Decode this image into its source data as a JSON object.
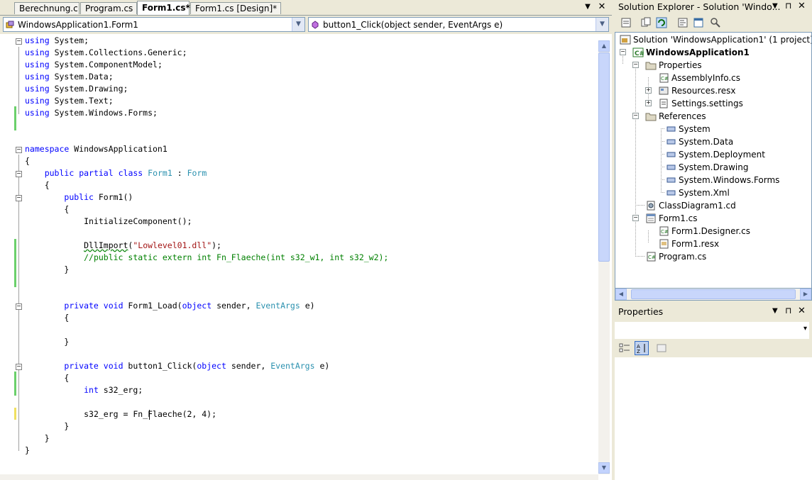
{
  "tabs": [
    {
      "label": "Berechnung.c",
      "active": false
    },
    {
      "label": "Program.cs",
      "active": false
    },
    {
      "label": "Form1.cs*",
      "active": true
    },
    {
      "label": "Form1.cs [Design]*",
      "active": false
    }
  ],
  "nav": {
    "class_combo": "WindowsApplication1.Form1",
    "member_combo": "button1_Click(object sender, EventArgs e)"
  },
  "code": {
    "l1": "System;",
    "l2": "System.Collections.Generic;",
    "l3": "System.ComponentModel;",
    "l4": "System.Data;",
    "l5": "System.Drawing;",
    "l6": "System.Text;",
    "l7": "System.Windows.Forms;",
    "kw_using": "using",
    "kw_namespace": "namespace",
    "namespace_name": " WindowsApplication1",
    "brace_open": "{",
    "brace_close": "}",
    "kw_public": "public",
    "kw_partial": "partial",
    "kw_class": "class",
    "type_form1": "Form1",
    "colon": " : ",
    "type_form": "Form",
    "ctor": " Form1()",
    "init": "InitializeComponent();",
    "dllimport": "DllImport",
    "paren_open": "(",
    "dll_string": "\"Lowlevel01.dll\"",
    "paren_close": ");",
    "comment": "//public static extern int Fn_Flaeche(int s32_w1, int s32_w2);",
    "kw_private": "private",
    "kw_void": "void",
    "form1_load": " Form1_Load(",
    "kw_object": "object",
    "sender": " sender, ",
    "type_eventargs": "EventArgs",
    "e_close": " e)",
    "button1_click": " button1_Click(",
    "kw_int": "int",
    "decl": " s32_erg;",
    "assign": "s32_erg = Fn_Flaeche(2, 4);"
  },
  "solution_explorer": {
    "title": "Solution Explorer - Solution 'Windo...",
    "items": [
      "Solution 'WindowsApplication1' (1 project)",
      "WindowsApplication1",
      "Properties",
      "AssemblyInfo.cs",
      "Resources.resx",
      "Settings.settings",
      "References",
      "System",
      "System.Data",
      "System.Deployment",
      "System.Drawing",
      "System.Windows.Forms",
      "System.Xml",
      "ClassDiagram1.cd",
      "Form1.cs",
      "Form1.Designer.cs",
      "Form1.resx",
      "Program.cs"
    ]
  },
  "properties_panel": {
    "title": "Properties"
  },
  "glyphs": {
    "dropdown": "▼",
    "pin": "⊓",
    "close": "✕",
    "up": "▲",
    "down": "▼",
    "left": "◀",
    "right": "▶",
    "minus": "−",
    "plus": "+",
    "combo_arrow": "▾"
  },
  "colors": {
    "keyword": "#0000ff",
    "type": "#2b91af",
    "string": "#a31515",
    "comment": "#008000",
    "changed_margin": "#6bd06b"
  }
}
